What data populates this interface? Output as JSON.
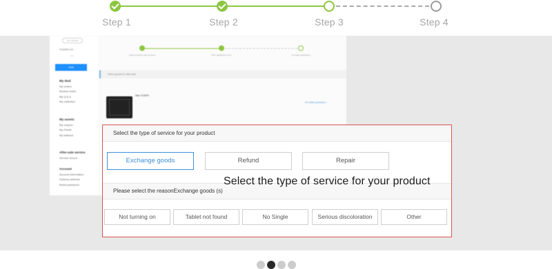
{
  "stepper": {
    "steps": [
      {
        "label": "Step 1",
        "state": "done"
      },
      {
        "label": "Step 2",
        "state": "done"
      },
      {
        "label": "Step 3",
        "state": "current"
      },
      {
        "label": "Step 4",
        "state": "todo"
      }
    ],
    "colors": {
      "done": "#8cc63f",
      "todo": "#9a9a9a",
      "label": "#a6a6a6"
    }
  },
  "background_page": {
    "sidebar": {
      "logo_text": "Join Chinese",
      "user_name": "Crystal Lee",
      "small_text": "Lv1",
      "button_label": "Visit",
      "groups": [
        {
          "title": "My deal",
          "items": [
            "My orders",
            "Review sheet",
            "My Q & A",
            "My collection"
          ]
        },
        {
          "title": "My assets",
          "items": [
            "My coupon",
            "My Points",
            "My balance"
          ]
        },
        {
          "title": "After-sale service",
          "items": [
            "Service record"
          ]
        },
        {
          "title": "Account",
          "items": [
            "Account information",
            "Delivery address",
            "Reset password"
          ]
        }
      ]
    },
    "progress": [
      {
        "label": "Select products and services"
      },
      {
        "label": "Fill in application form"
      },
      {
        "label": "Complete application"
      }
    ],
    "section_title": "Select goods for after-sale",
    "product_name": "Star Y1X870",
    "product_link": "For other products >"
  },
  "modal": {
    "header": "Select the type of service for your product",
    "service_options": [
      {
        "label": "Exchange goods",
        "selected": true
      },
      {
        "label": "Refund",
        "selected": false
      },
      {
        "label": "Repair",
        "selected": false
      }
    ],
    "caption": "Select the type of service for your product",
    "reason_header": "Please select the reasonExchange goods (s)",
    "reasons": [
      "Not turning on",
      "Tablet not found",
      "No Single",
      "Serious discoloration",
      "Other"
    ],
    "border_color": "#d9534f",
    "selected_color": "#3b8fd9"
  },
  "carousel": {
    "count": 4,
    "active_index": 1
  }
}
